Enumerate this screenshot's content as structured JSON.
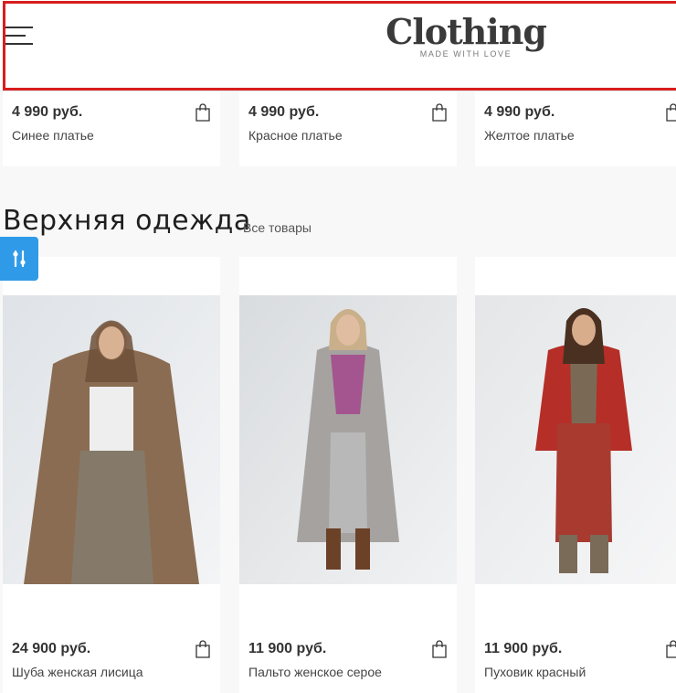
{
  "header": {
    "logo_title": "Clothing",
    "logo_tagline": "MADE WITH LOVE"
  },
  "top_products": [
    {
      "price": "4 990 руб.",
      "name": "Синее платье"
    },
    {
      "price": "4 990 руб.",
      "name": "Красное платье"
    },
    {
      "price": "4 990 руб.",
      "name": "Желтое платье"
    }
  ],
  "section": {
    "title": "Верхняя одежда",
    "all_link": "Все товары"
  },
  "products": [
    {
      "price": "24 900 руб.",
      "name": "Шуба женская лисица",
      "coat_color": "#8a6c52",
      "pants_color": "#857a6a"
    },
    {
      "price": "11 900 руб.",
      "name": "Пальто женское серое",
      "coat_color": "#a5a2a0",
      "pants_color": "#b9b8b8"
    },
    {
      "price": "11 900 руб.",
      "name": "Пуховик красный",
      "coat_color": "#b52e27",
      "pants_color": "#a83a30"
    }
  ],
  "colors": {
    "accent": "#2f9be8",
    "outline": "#d81e1e"
  },
  "icons": {
    "menu": "hamburger-icon",
    "cart": "shopping-bag-icon",
    "filter": "sliders-icon"
  }
}
